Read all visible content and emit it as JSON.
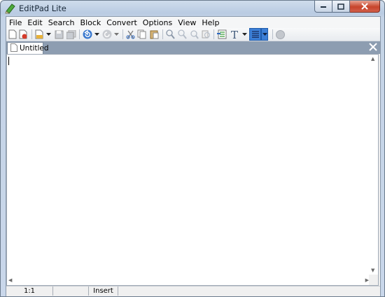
{
  "window": {
    "title": "EditPad Lite",
    "buttons": {
      "minimize": "minimize",
      "maximize": "maximize",
      "close": "close"
    }
  },
  "menu": [
    "File",
    "Edit",
    "Search",
    "Block",
    "Convert",
    "Options",
    "View",
    "Help"
  ],
  "toolbar": {
    "buttons": [
      "new-file-icon",
      "close-file-icon",
      "open-file-icon",
      "open-dropdown-icon",
      "save-icon",
      "save-all-icon",
      "undo-icon",
      "undo-dropdown-icon",
      "redo-icon",
      "redo-dropdown-icon",
      "cut-icon",
      "copy-icon",
      "paste-icon",
      "find-icon",
      "find-next-icon",
      "find-previous-icon",
      "replace-icon",
      "insert-icon",
      "font-icon",
      "font-dropdown-icon",
      "word-wrap-icon",
      "word-wrap-dropdown-icon",
      "stop-icon"
    ]
  },
  "tabs": [
    {
      "label": "Untitled",
      "active": true
    }
  ],
  "editor": {
    "content": ""
  },
  "status": {
    "position": "1:1",
    "modified": "",
    "mode": "Insert"
  },
  "colors": {
    "accent": "#3c7fd6",
    "titlebar": "#c4d3e6",
    "tabstrip": "#8d9db1",
    "close_button": "#c7442b"
  }
}
